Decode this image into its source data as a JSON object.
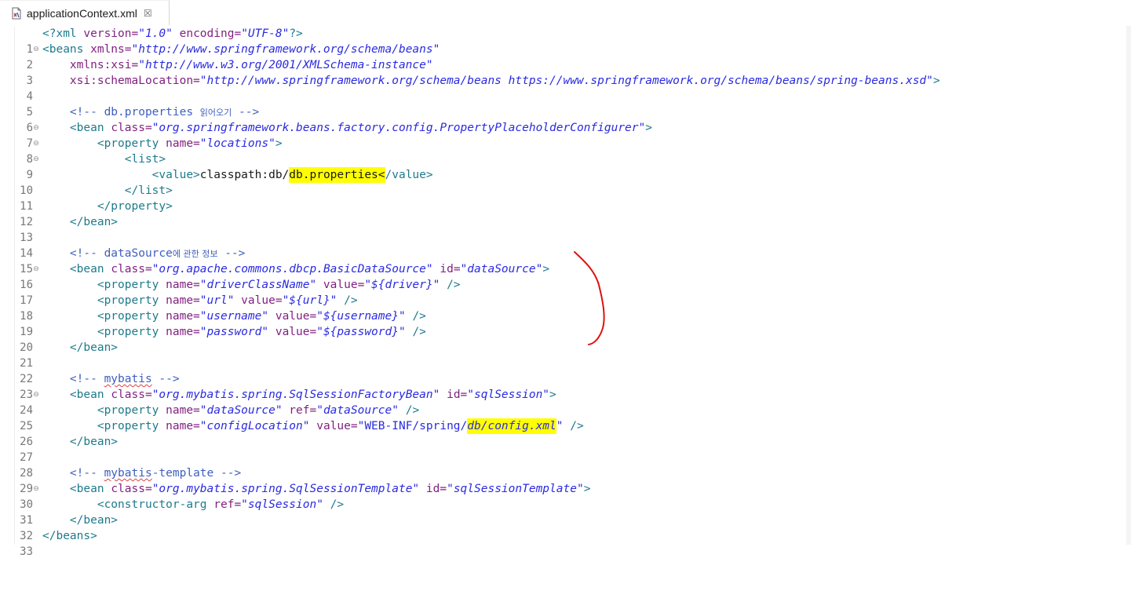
{
  "tab": {
    "title": "applicationContext.xml",
    "close": "☒",
    "icon": "xml-file-icon"
  },
  "editor": {
    "lines": [
      {
        "n": "1"
      },
      {
        "n": "2",
        "fold": "⊖"
      },
      {
        "n": "3"
      },
      {
        "n": "4"
      },
      {
        "n": "5"
      },
      {
        "n": "6"
      },
      {
        "n": "7",
        "fold": "⊖"
      },
      {
        "n": "8",
        "fold": "⊖"
      },
      {
        "n": "9",
        "fold": "⊖"
      },
      {
        "n": "10"
      },
      {
        "n": "11"
      },
      {
        "n": "12"
      },
      {
        "n": "13"
      },
      {
        "n": "14"
      },
      {
        "n": "15"
      },
      {
        "n": "16",
        "fold": "⊖"
      },
      {
        "n": "17"
      },
      {
        "n": "18"
      },
      {
        "n": "19"
      },
      {
        "n": "20"
      },
      {
        "n": "21"
      },
      {
        "n": "22"
      },
      {
        "n": "23"
      },
      {
        "n": "24",
        "fold": "⊖"
      },
      {
        "n": "25"
      },
      {
        "n": "26"
      },
      {
        "n": "27"
      },
      {
        "n": "28"
      },
      {
        "n": "29"
      },
      {
        "n": "30",
        "fold": "⊖"
      },
      {
        "n": "31"
      },
      {
        "n": "32"
      },
      {
        "n": "33"
      }
    ],
    "code": {
      "l1": {
        "a": "<?xml ",
        "b": "version=",
        "c": "\"1.0\"",
        "d": " encoding=",
        "e": "\"UTF-8\"",
        "f": "?>"
      },
      "l2": {
        "a": "<beans ",
        "b": "xmlns=",
        "c": "\"http://www.springframework.org/schema/beans\""
      },
      "l3": {
        "a": "    xmlns:xsi=",
        "b": "\"http://www.w3.org/2001/XMLSchema-instance\""
      },
      "l4": {
        "a": "    xsi:schemaLocation=",
        "b": "\"http://www.springframework.org/schema/beans https://www.springframework.org/schema/beans/spring-beans.xsd\"",
        "c": ">"
      },
      "l6": {
        "a": "    <!-- db.properties ",
        "b": "읽어오기",
        "c": " -->"
      },
      "l7": {
        "a": "    <bean ",
        "b": "class=",
        "c": "\"org.springframework.beans.factory.config.PropertyPlaceholderConfigurer\"",
        "d": ">"
      },
      "l8": {
        "a": "        <property ",
        "b": "name=",
        "c": "\"locations\"",
        "d": ">"
      },
      "l9": {
        "a": "            <list>"
      },
      "l10": {
        "a": "                <value>",
        "b": "classpath:db/",
        "c": "db.properties<",
        "d": "/value>"
      },
      "l11": {
        "a": "            </list>"
      },
      "l12": {
        "a": "        </property>"
      },
      "l13": {
        "a": "    </bean>"
      },
      "l15": {
        "a": "    <!-- dataSource",
        "b": "에 관한 정보",
        "c": " -->"
      },
      "l16": {
        "a": "    <bean ",
        "b": "class=",
        "c": "\"org.apache.commons.dbcp.BasicDataSource\"",
        "d": " id=",
        "e": "\"dataSource\"",
        "f": ">"
      },
      "l17": {
        "a": "        <property ",
        "b": "name=",
        "c": "\"driverClassName\"",
        "d": " value=",
        "e": "\"${driver}\"",
        "f": " />"
      },
      "l18": {
        "a": "        <property ",
        "b": "name=",
        "c": "\"url\"",
        "d": " value=",
        "e": "\"${url}\"",
        "f": " />"
      },
      "l19": {
        "a": "        <property ",
        "b": "name=",
        "c": "\"username\"",
        "d": " value=",
        "e": "\"${username}\"",
        "f": " />"
      },
      "l20": {
        "a": "        <property ",
        "b": "name=",
        "c": "\"password\"",
        "d": " value=",
        "e": "\"${password}\"",
        "f": " />"
      },
      "l21": {
        "a": "    </bean>"
      },
      "l23": {
        "a": "    <!-- ",
        "b": "mybatis",
        "c": " -->"
      },
      "l24": {
        "a": "    <bean ",
        "b": "class=",
        "c": "\"org.mybatis.spring.SqlSessionFactoryBean\"",
        "d": " id=",
        "e": "\"sqlSession\"",
        "f": ">"
      },
      "l25": {
        "a": "        <property ",
        "b": "name=",
        "c": "\"dataSource\"",
        "d": " ref=",
        "e": "\"dataSource\"",
        "f": " />"
      },
      "l26": {
        "a": "        <property ",
        "b": "name=",
        "c": "\"configLocation\"",
        "d": " value=",
        "e": "\"WEB-INF/spring/",
        "f": "db/config.xml",
        "g": "\"",
        "h": " />"
      },
      "l27": {
        "a": "    </bean>"
      },
      "l29": {
        "a": "    <!-- ",
        "b": "mybatis",
        "c": "-template -->"
      },
      "l30": {
        "a": "    <bean ",
        "b": "class=",
        "c": "\"org.mybatis.spring.SqlSessionTemplate\"",
        "d": " id=",
        "e": "\"sqlSessionTemplate\"",
        "f": ">"
      },
      "l31": {
        "a": "        <constructor-arg ",
        "b": "ref=",
        "c": "\"sqlSession\"",
        "d": " />"
      },
      "l32": {
        "a": "    </bean>"
      },
      "l33": {
        "a": "</beans>"
      }
    }
  },
  "colors": {
    "tag": "#1e7a8c",
    "attribute": "#7f1f7f",
    "value": "#2a2ae0",
    "comment": "#3f5fbf",
    "highlight": "#ffff00",
    "annotation": "#e01010"
  }
}
